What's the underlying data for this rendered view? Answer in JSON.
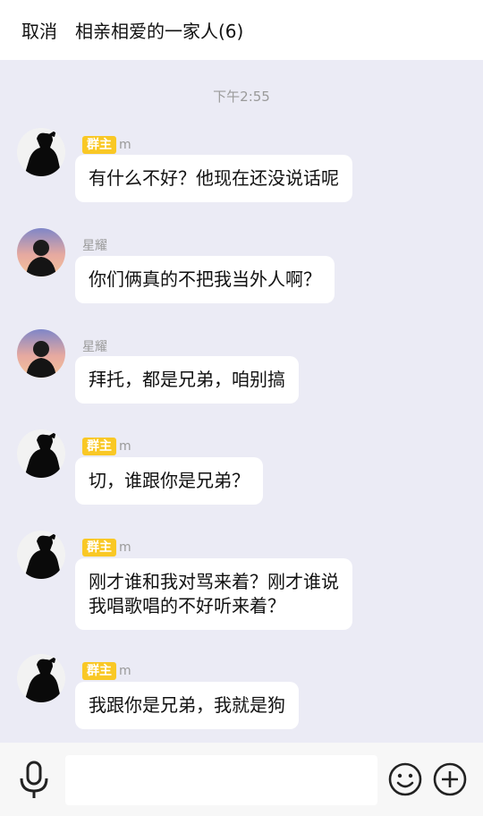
{
  "header": {
    "cancel_label": "取消",
    "title": "相亲相爱的一家人(6)"
  },
  "chat": {
    "timestamp": "下午2:55",
    "messages": [
      {
        "sender": "m",
        "badge": "群主",
        "avatar": "dark-figure-avatar",
        "text": "有什么不好？他现在还没说话呢"
      },
      {
        "sender": "星耀",
        "badge": "",
        "avatar": "sunset-portrait-avatar",
        "text": "你们俩真的不把我当外人啊？"
      },
      {
        "sender": "星耀",
        "badge": "",
        "avatar": "sunset-portrait-avatar",
        "text": "拜托，都是兄弟，咱别搞"
      },
      {
        "sender": "m",
        "badge": "群主",
        "avatar": "dark-figure-avatar",
        "text": "切，谁跟你是兄弟？"
      },
      {
        "sender": "m",
        "badge": "群主",
        "avatar": "dark-figure-avatar",
        "text": "刚才谁和我对骂来着？刚才谁说\n我唱歌唱的不好听来着？"
      },
      {
        "sender": "m",
        "badge": "群主",
        "avatar": "dark-figure-avatar",
        "text": "我跟你是兄弟，我就是狗"
      }
    ]
  },
  "input": {
    "placeholder": ""
  },
  "icons": {
    "mic": "microphone-icon",
    "emoji": "emoji-icon",
    "plus": "plus-icon"
  }
}
